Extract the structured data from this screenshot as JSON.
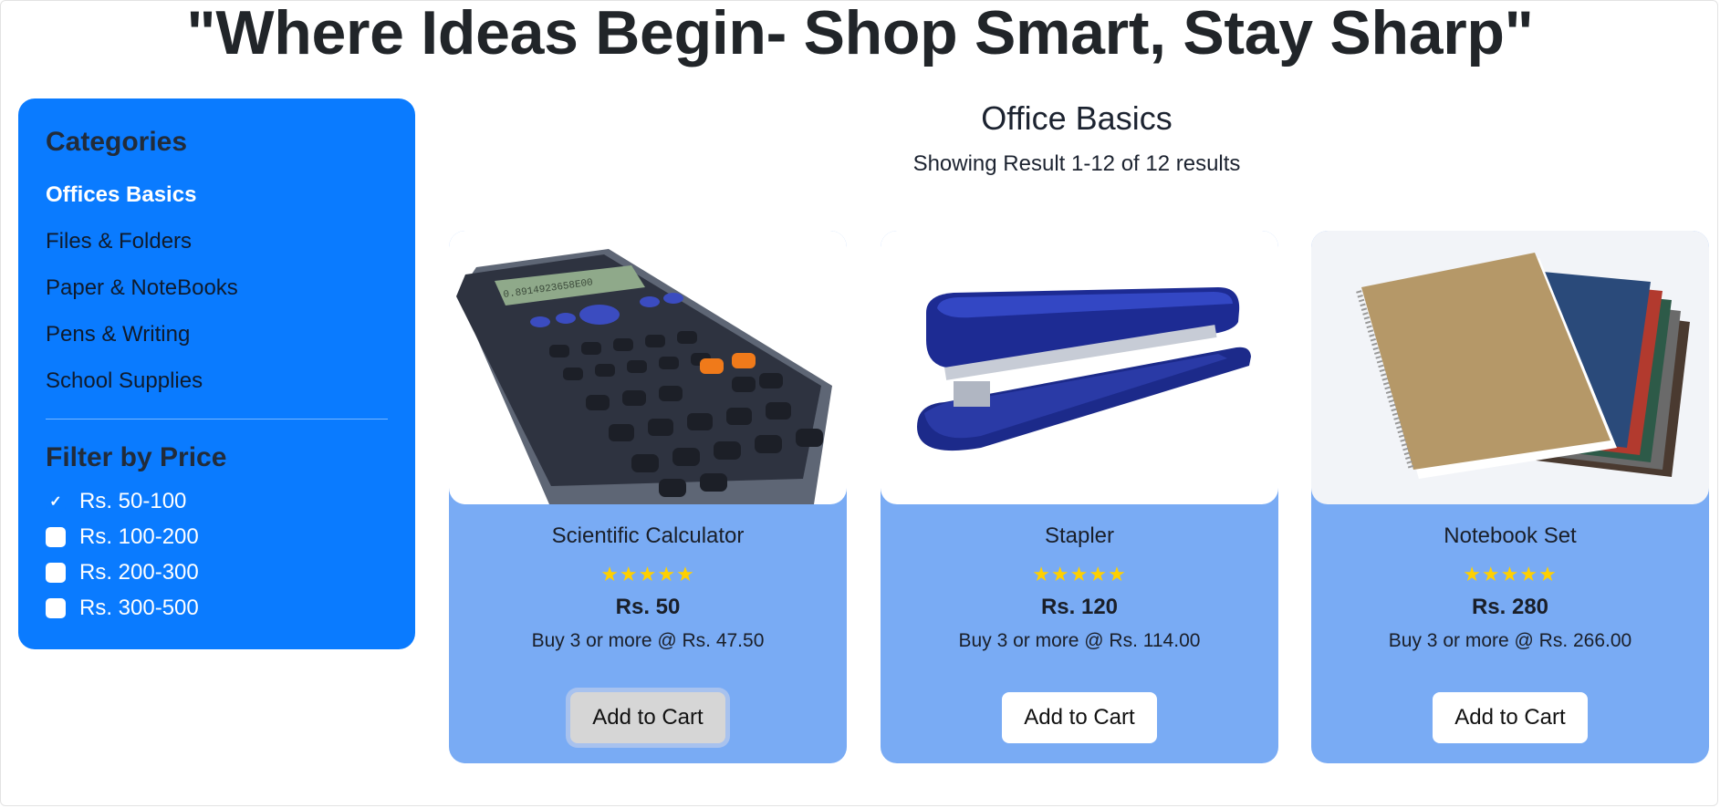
{
  "header": {
    "title": "\"Where Ideas Begin- Shop Smart, Stay Sharp\""
  },
  "sidebar": {
    "categories_title": "Categories",
    "categories": [
      {
        "label": "Offices Basics",
        "active": true
      },
      {
        "label": "Files & Folders",
        "active": false
      },
      {
        "label": "Paper & NoteBooks",
        "active": false
      },
      {
        "label": "Pens & Writing",
        "active": false
      },
      {
        "label": "School Supplies",
        "active": false
      }
    ],
    "filter_title": "Filter by Price",
    "filters": [
      {
        "label": "Rs. 50-100",
        "checked": true
      },
      {
        "label": "Rs. 100-200",
        "checked": false
      },
      {
        "label": "Rs. 200-300",
        "checked": false
      },
      {
        "label": "Rs. 300-500",
        "checked": false
      }
    ]
  },
  "main": {
    "section_title": "Office Basics",
    "results_text": "Showing Result 1-12 of 12 results"
  },
  "products": [
    {
      "name": "Scientific Calculator",
      "stars": "★★★★★",
      "rating": 5,
      "price": "Rs. 50",
      "bulk": "Buy 3 or more @ Rs. 47.50",
      "button": "Add to Cart",
      "image_icon": "calculator-image"
    },
    {
      "name": "Stapler",
      "stars": "★★★★★",
      "rating": 5,
      "price": "Rs. 120",
      "bulk": "Buy 3 or more @ Rs. 114.00",
      "button": "Add to Cart",
      "image_icon": "stapler-image"
    },
    {
      "name": "Notebook Set",
      "stars": "★★★★★",
      "rating": 5,
      "price": "Rs. 280",
      "bulk": "Buy 3 or more @ Rs. 266.00",
      "button": "Add to Cart",
      "image_icon": "notebook-set-image"
    }
  ],
  "colors": {
    "sidebar_bg": "#0a7bff",
    "card_bg": "#79abf4",
    "star": "#ffd000"
  }
}
